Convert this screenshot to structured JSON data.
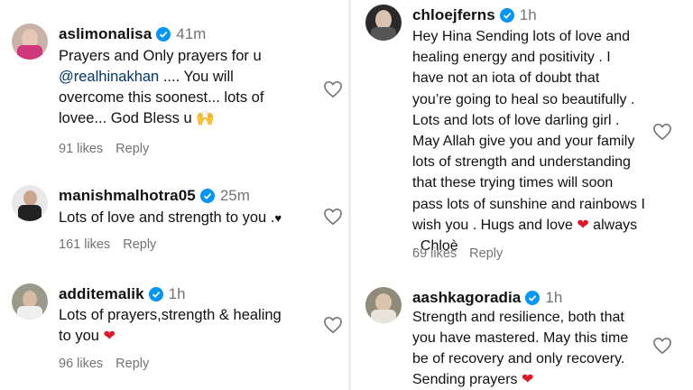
{
  "left_comments": [
    {
      "username": "aslimonalisa",
      "time": "41m",
      "lines": [
        "Prayers and Only prayers for u"
      ],
      "mention": "@realhinakhan",
      "after_mention": " .... You will",
      "lines2": [
        "overcome this soonest... lots of",
        "lovee... God Bless u"
      ],
      "emoji": "🙌",
      "likes": "91 likes",
      "reply": "Reply"
    },
    {
      "username": "manishmalhotra05",
      "time": "25m",
      "text": "Lots of love and strength to you .",
      "emoji": "♥",
      "likes": "161 likes",
      "reply": "Reply"
    },
    {
      "username": "additemalik",
      "time": "1h",
      "line1": "Lots of prayers,strength & healing",
      "line2": "to you",
      "emoji": "❤",
      "likes": "96 likes",
      "reply": "Reply"
    }
  ],
  "right_comments": [
    {
      "username": "chloejferns",
      "time": "1h",
      "lines": [
        "Hey Hina Sending lots of love and",
        "healing energy and positivity . I",
        "have not an iota of doubt that",
        "you’re going to heal so beautifully .",
        "Lots and lots of love darling girl .",
        "May Allah give you and your family",
        "lots of strength and understanding",
        "that these trying times will soon",
        "pass lots of sunshine and rainbows I"
      ],
      "line_last_a": "wish you . Hugs and love ",
      "emoji": "❤",
      "line_last_b": " always",
      "line_end": ". Chloè",
      "likes": "69 likes",
      "reply": "Reply"
    },
    {
      "username": "aashkagoradia",
      "time": "1h",
      "lines": [
        "Strength and resilience, both that",
        "you have mastered. May this time",
        "be of recovery and only recovery."
      ],
      "line_last": "Sending prayers ",
      "emoji": "❤"
    }
  ],
  "icons": {
    "verified": "verified-badge-icon",
    "like": "heart-outline-icon"
  },
  "colors": {
    "verified": "#0095f6",
    "muted": "#737373",
    "mention": "#00376b",
    "heart": "#e0162b"
  }
}
